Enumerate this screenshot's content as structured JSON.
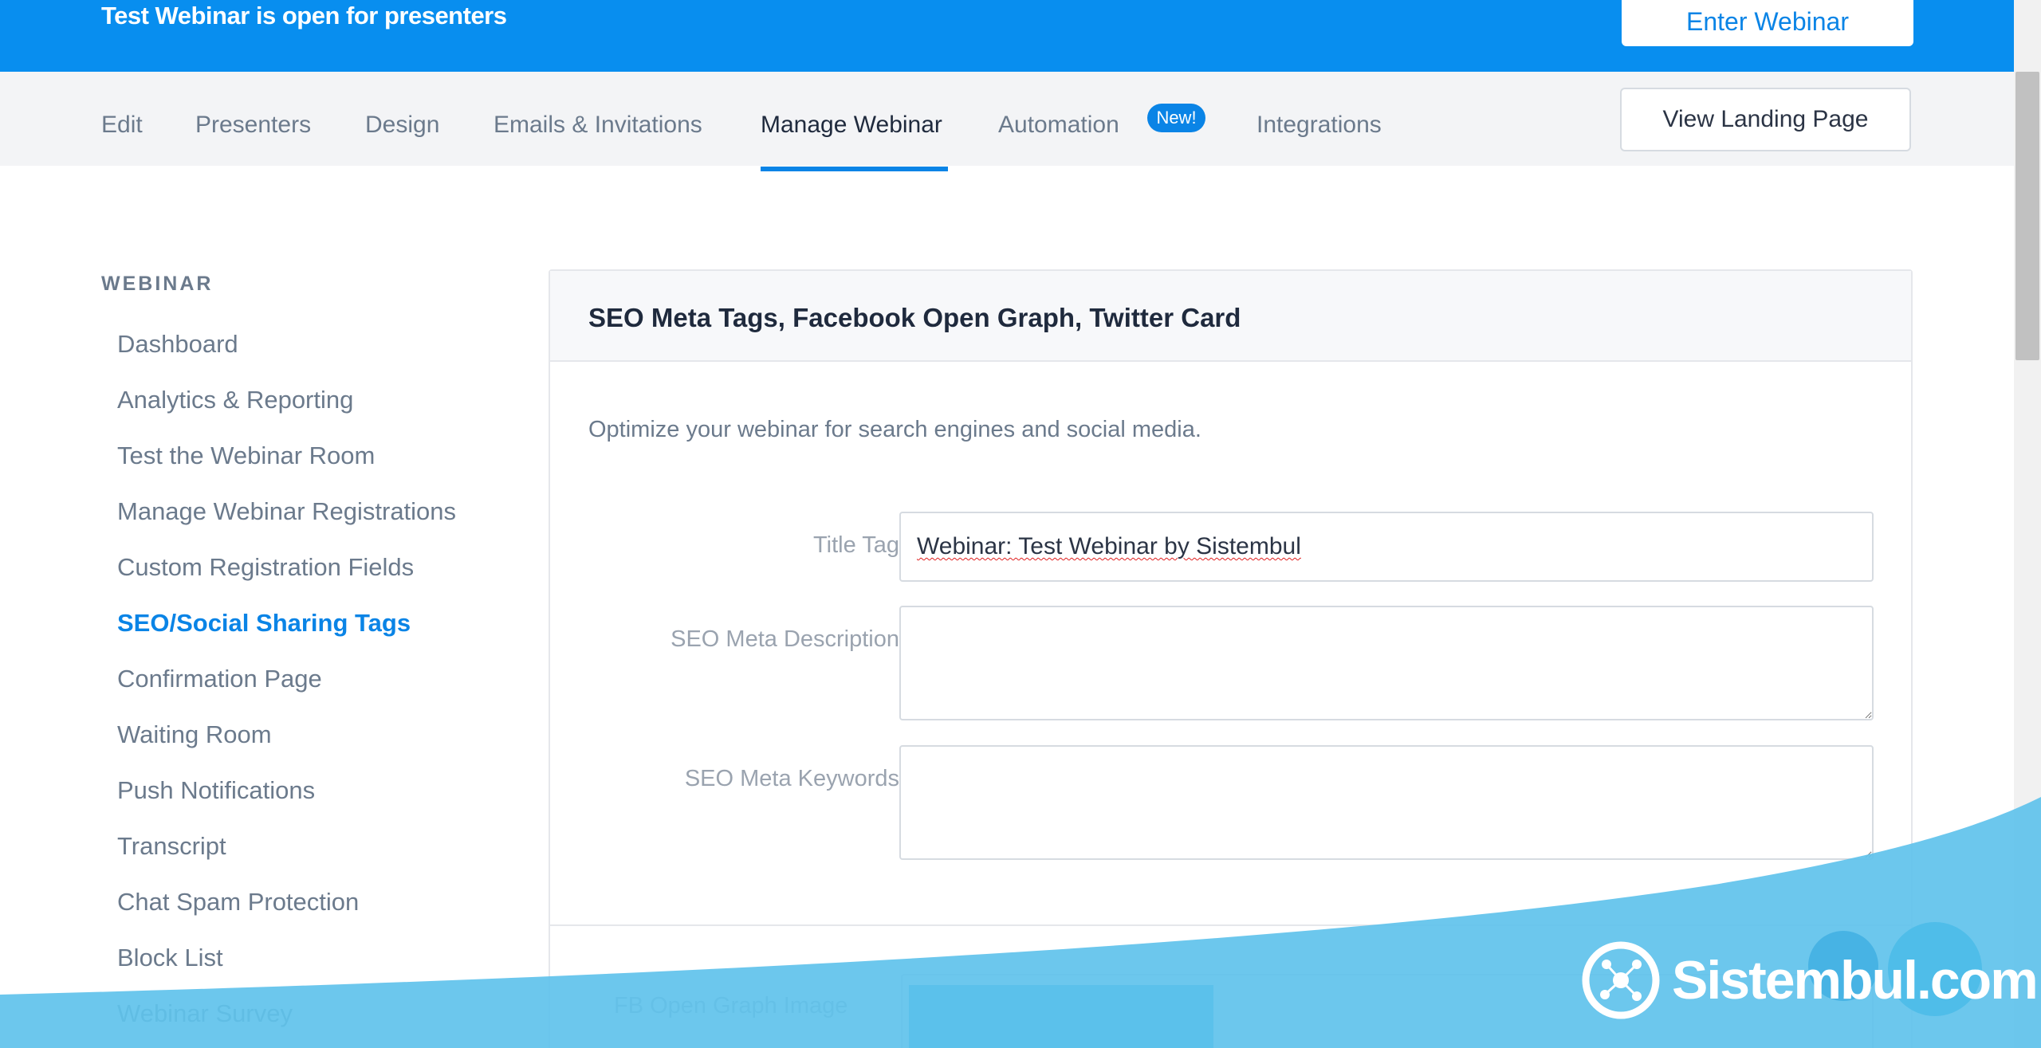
{
  "banner": {
    "title": "Test Webinar is open for presenters",
    "enter_button": "Enter Webinar"
  },
  "nav": {
    "tabs": [
      {
        "label": "Edit"
      },
      {
        "label": "Presenters"
      },
      {
        "label": "Design"
      },
      {
        "label": "Emails & Invitations"
      },
      {
        "label": "Manage Webinar"
      },
      {
        "label": "Automation"
      },
      {
        "label": "Integrations"
      }
    ],
    "new_badge": "New!",
    "view_landing_button": "View Landing Page"
  },
  "sidebar": {
    "heading": "WEBINAR",
    "items": [
      {
        "label": "Dashboard"
      },
      {
        "label": "Analytics & Reporting"
      },
      {
        "label": "Test the Webinar Room"
      },
      {
        "label": "Manage Webinar Registrations"
      },
      {
        "label": "Custom Registration Fields"
      },
      {
        "label": "SEO/Social Sharing Tags"
      },
      {
        "label": "Confirmation Page"
      },
      {
        "label": "Waiting Room"
      },
      {
        "label": "Push Notifications"
      },
      {
        "label": "Transcript"
      },
      {
        "label": "Chat Spam Protection"
      },
      {
        "label": "Block List"
      },
      {
        "label": "Webinar Survey"
      }
    ],
    "active_item": "SEO/Social Sharing Tags"
  },
  "card": {
    "title": "SEO Meta Tags, Facebook Open Graph, Twitter Card",
    "description": "Optimize your webinar for search engines and social media.",
    "fields": {
      "title_tag": {
        "label": "Title Tag",
        "value": "Webinar: Test Webinar by Sistembul"
      },
      "meta_description": {
        "label": "SEO Meta Description",
        "value": ""
      },
      "meta_keywords": {
        "label": "SEO Meta Keywords",
        "value": ""
      }
    },
    "og_image_label": "FB Open Graph Image"
  },
  "watermark": {
    "text": "Sistembul.com"
  },
  "colors": {
    "primary": "#088eef",
    "accent": "#0a84e6",
    "wave": "#5fc2ec"
  }
}
